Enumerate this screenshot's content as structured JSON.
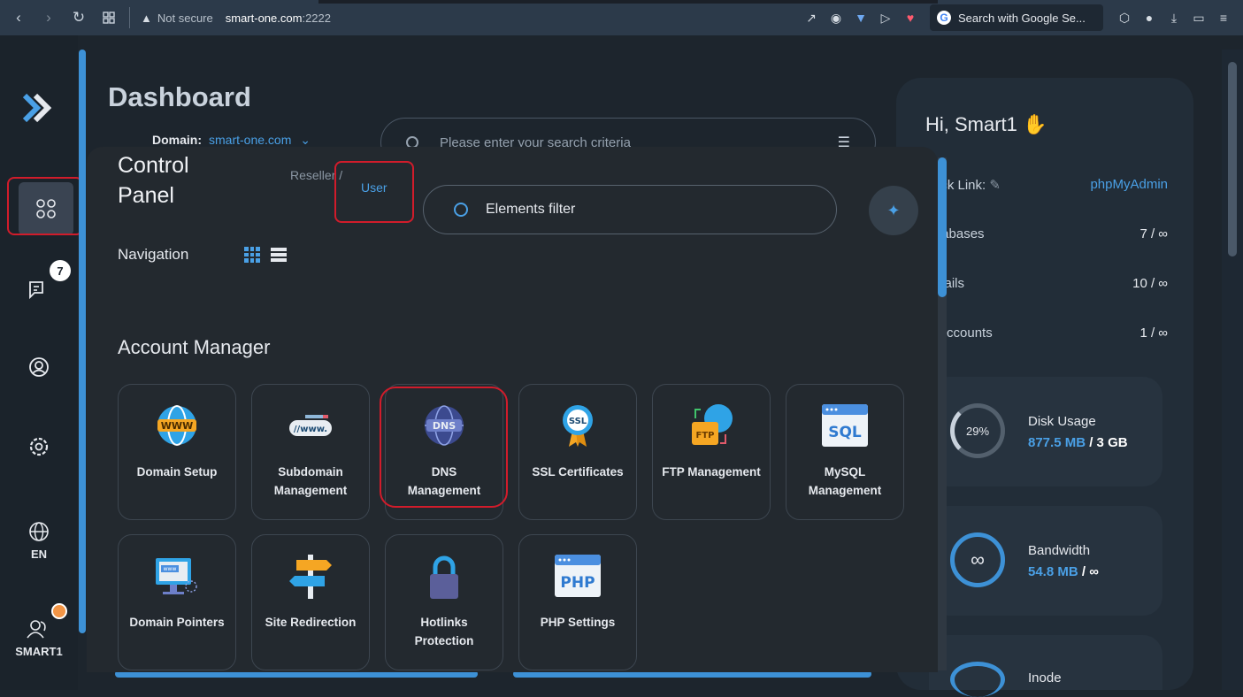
{
  "browser": {
    "security_label": "Not secure",
    "host": "smart-one.com",
    "port": ":2222",
    "search_placeholder": "Search with Google Se..."
  },
  "sidebar": {
    "chat_badge": "7",
    "language": "EN",
    "user": "SMART1"
  },
  "dashboard": {
    "title": "Dashboard",
    "domain_label": "Domain:",
    "domain_value": "smart-one.com",
    "search_placeholder": "Please enter your search criteria"
  },
  "right_panel": {
    "greeting": "Hi, Smart1",
    "quick_link_label": "ick Link:",
    "quick_link_value": "phpMyAdmin",
    "rows": [
      {
        "label": "tabases",
        "value": "7 / ∞"
      },
      {
        "label": "Jails",
        "value": "10 / ∞"
      },
      {
        "label": "Accounts",
        "value": "1 / ∞"
      }
    ],
    "disk": {
      "percent": "29%",
      "name": "Disk Usage",
      "used": "877.5 MB",
      "total": "/ 3 GB"
    },
    "bandwidth": {
      "symbol": "∞",
      "name": "Bandwidth",
      "used": "54.8 MB",
      "total": "/ ∞"
    },
    "inode": {
      "name": "Inode"
    }
  },
  "control_panel": {
    "title_line1": "Control",
    "title_line2": "Panel",
    "crumb_reseller": "Reseller /",
    "crumb_user": "User",
    "filter_placeholder": "Elements filter",
    "navigation_label": "Navigation",
    "section_title": "Account Manager",
    "tiles": [
      {
        "label_1": "Domain Setup",
        "label_2": "",
        "icon": "www-globe-icon"
      },
      {
        "label_1": "Subdomain",
        "label_2": "Management",
        "icon": "subdomain-bar-icon"
      },
      {
        "label_1": "DNS",
        "label_2": "Management",
        "icon": "dns-globe-icon"
      },
      {
        "label_1": "SSL Certificates",
        "label_2": "",
        "icon": "ssl-badge-icon"
      },
      {
        "label_1": "FTP Management",
        "label_2": "",
        "icon": "ftp-folder-icon"
      },
      {
        "label_1": "MySQL",
        "label_2": "Management",
        "icon": "sql-window-icon"
      },
      {
        "label_1": "Domain Pointers",
        "label_2": "",
        "icon": "monitor-www-icon"
      },
      {
        "label_1": "Site Redirection",
        "label_2": "",
        "icon": "signpost-icon"
      },
      {
        "label_1": "Hotlinks",
        "label_2": "Protection",
        "icon": "padlock-icon"
      },
      {
        "label_1": "PHP Settings",
        "label_2": "",
        "icon": "php-window-icon"
      }
    ]
  },
  "colors": {
    "accent": "#4aa0e6",
    "highlight": "#d11c2b",
    "background": "#1d252d"
  }
}
